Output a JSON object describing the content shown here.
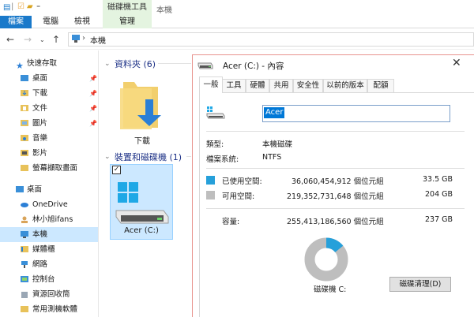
{
  "ribbon": {
    "tools_header": "磁碟機工具",
    "window_title": "本機",
    "tabs": [
      "檔案",
      "電腦",
      "檢視",
      "管理"
    ]
  },
  "address": {
    "path": "本機"
  },
  "nav": {
    "quick_access": "快速存取",
    "items": [
      {
        "label": "桌面",
        "pinned": true
      },
      {
        "label": "下載",
        "pinned": true
      },
      {
        "label": "文件",
        "pinned": true
      },
      {
        "label": "圖片",
        "pinned": true
      },
      {
        "label": "音樂"
      },
      {
        "label": "影片"
      },
      {
        "label": "螢幕擷取畫面"
      }
    ],
    "desktop": "桌面",
    "onedrive": "OneDrive",
    "user": "林小旭ifans",
    "this_pc": "本機",
    "media": "媒體櫃",
    "network": "網路",
    "control_panel": "控制台",
    "recycle": "資源回收筒",
    "tools": "常用測機軟體"
  },
  "content": {
    "folders_header": "資料夾 (6)",
    "download_label": "下載",
    "drives_header": "裝置和磁碟機 (1)",
    "drive_label": "Acer (C:)"
  },
  "dialog": {
    "title": "Acer (C:) - 內容",
    "close": "✕",
    "tabs": [
      "一般",
      "工具",
      "硬體",
      "共用",
      "安全性",
      "以前的版本",
      "配額"
    ],
    "name_value": "Acer",
    "type_label": "類型:",
    "type_value": "本機磁碟",
    "fs_label": "檔案系統:",
    "fs_value": "NTFS",
    "used_label": "已使用空間:",
    "used_bytes": "36,060,454,912 個位元組",
    "used_gb": "33.5 GB",
    "free_label": "可用空間:",
    "free_bytes": "219,352,731,648 個位元組",
    "free_gb": "204 GB",
    "cap_label": "容量:",
    "cap_bytes": "255,413,186,560 個位元組",
    "cap_gb": "237 GB",
    "drive_caption": "磁碟機 C:",
    "cleanup_button": "磁碟清理(D)",
    "used_fraction": 0.141,
    "colors": {
      "used": "#26a0da",
      "free": "#bebebe"
    }
  }
}
